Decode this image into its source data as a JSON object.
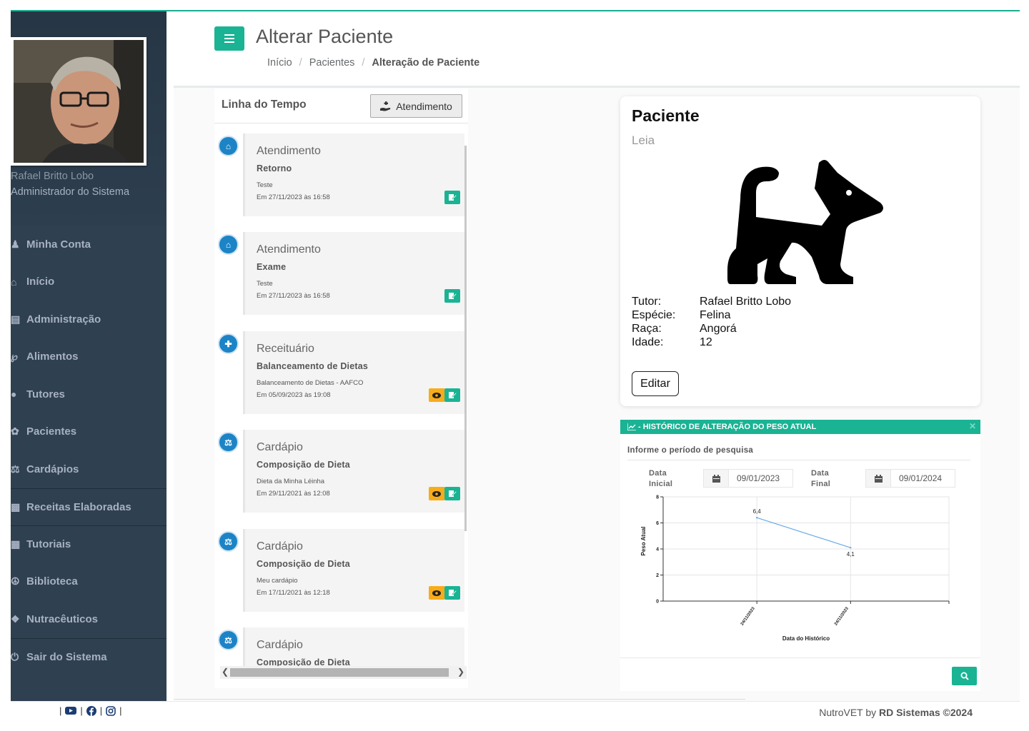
{
  "page": {
    "title": "Alterar Paciente",
    "breadcrumb": [
      "Início",
      "Pacientes",
      "Alteração de Paciente"
    ]
  },
  "sidebar": {
    "user_name": "Rafael Britto Lobo",
    "user_role": "Administrador do Sistema",
    "items": [
      {
        "label": "Minha Conta",
        "icon": "user-group-icon"
      },
      {
        "label": "Início",
        "icon": "home-icon"
      },
      {
        "label": "Administração",
        "icon": "bank-icon"
      },
      {
        "label": "Alimentos",
        "icon": "cutlery-icon"
      },
      {
        "label": "Tutores",
        "icon": "user-icon"
      },
      {
        "label": "Pacientes",
        "icon": "paw-icon"
      },
      {
        "label": "Cardápios",
        "icon": "scale-icon"
      },
      {
        "label": "Receitas Elaboradas",
        "icon": "prescription-icon"
      },
      {
        "label": "Tutoriais",
        "icon": "tutorial-icon"
      },
      {
        "label": "Biblioteca",
        "icon": "library-icon"
      },
      {
        "label": "Nutracêuticos",
        "icon": "pill-icon"
      },
      {
        "label": "Sair do Sistema",
        "icon": "power-icon"
      }
    ]
  },
  "timeline": {
    "title": "Linha do Tempo",
    "button_label": "Atendimento",
    "items": [
      {
        "kind": "Atendimento",
        "subtitle": "Retorno",
        "note": "Teste",
        "date": "Em 27/11/2023 às 16:58",
        "icon": "clinic-icon",
        "has_view": false
      },
      {
        "kind": "Atendimento",
        "subtitle": "Exame",
        "note": "Teste",
        "date": "Em 27/11/2023 às 16:58",
        "icon": "clinic-icon",
        "has_view": false
      },
      {
        "kind": "Receituário",
        "subtitle": "Balanceamento de Dietas",
        "note": "Balanceamento de Dietas - AAFCO",
        "date": "Em 05/09/2023 às 19:08",
        "icon": "prescription-icon",
        "has_view": true
      },
      {
        "kind": "Cardápio",
        "subtitle": "Composição de Dieta",
        "note": "Dieta da Minha Léinha",
        "date": "Em 29/11/2021 às 12:08",
        "icon": "scale-icon",
        "has_view": true
      },
      {
        "kind": "Cardápio",
        "subtitle": "Composição de Dieta",
        "note": "Meu cardápio",
        "date": "Em 17/11/2021 às 12:18",
        "icon": "scale-icon",
        "has_view": true
      },
      {
        "kind": "Cardápio",
        "subtitle": "Composição de Dieta",
        "note": "",
        "date": "",
        "icon": "scale-icon",
        "has_view": false
      }
    ]
  },
  "patient": {
    "heading": "Paciente",
    "name": "Leia",
    "fields": [
      {
        "label": "Tutor:",
        "value": "Rafael Britto Lobo"
      },
      {
        "label": "Espécie:",
        "value": "Felina"
      },
      {
        "label": "Raça:",
        "value": "Angorá"
      },
      {
        "label": "Idade:",
        "value": "12"
      }
    ],
    "edit_label": "Editar",
    "image_icon": "cat-icon"
  },
  "weight_history": {
    "header": "- HISTÓRICO DE ALTERAÇÃO DO PESO ATUAL",
    "period_label": "Informe o período de pesquisa",
    "start_label_1": "Data",
    "start_label_2": "Inicial",
    "start_value": "09/01/2023",
    "end_label_1": "Data",
    "end_label_2": "Final",
    "end_value": "09/01/2024"
  },
  "chart_data": {
    "type": "line",
    "categories": [
      "24/11/2023",
      "24/11/2023"
    ],
    "series": [
      {
        "values": [
          6.4,
          4.1
        ],
        "labels": [
          "6,4",
          "4,1"
        ],
        "color": "#6aa9e8"
      }
    ],
    "xlabel": "Data do Histórico",
    "ylabel": "Peso Atual",
    "ylim": [
      0,
      8
    ],
    "yticks": [
      0,
      2,
      4,
      6,
      8
    ],
    "grid": true
  },
  "footer": {
    "credit_prefix": "NutroVET by",
    "credit_brand": "RD Sistemas ©2024",
    "social": [
      "youtube-icon",
      "facebook-icon",
      "instagram-icon"
    ],
    "separator": "|"
  },
  "colors": {
    "accent": "#1ab394",
    "sidebar": "#2f4050",
    "timeline_icon": "#1c84c6",
    "view_button": "#f8ac1a"
  }
}
